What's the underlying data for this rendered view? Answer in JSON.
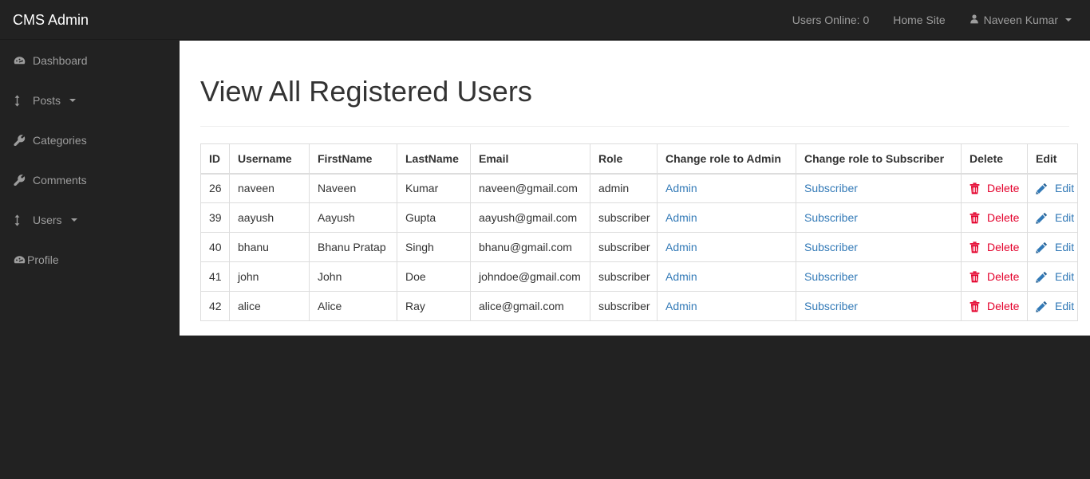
{
  "topbar": {
    "brand": "CMS Admin",
    "items": [
      {
        "label": "Users Online: 0",
        "icon": ""
      },
      {
        "label": "Home Site",
        "icon": ""
      },
      {
        "label": "Naveen Kumar",
        "icon": "user-icon"
      }
    ]
  },
  "sidebar": {
    "items": [
      {
        "label": "Dashboard",
        "icon": "tachometer-icon",
        "caret": false
      },
      {
        "label": "Posts",
        "icon": "arrows-v-icon",
        "caret": true
      },
      {
        "label": "Categories",
        "icon": "wrench-icon",
        "caret": false
      },
      {
        "label": "Comments",
        "icon": "wrench-icon",
        "caret": false
      },
      {
        "label": "Users",
        "icon": "arrows-v-icon",
        "caret": true
      },
      {
        "label": "Profile",
        "icon": "tachometer-icon",
        "caret": false
      }
    ]
  },
  "main": {
    "title": "View All Registered Users",
    "table": {
      "headers": [
        "ID",
        "Username",
        "FirstName",
        "LastName",
        "Email",
        "Role",
        "Change role to Admin",
        "Change role to Subscriber",
        "Delete",
        "Edit"
      ],
      "rows": [
        {
          "id": "26",
          "username": "naveen",
          "firstname": "Naveen",
          "lastname": "Kumar",
          "email": "naveen@gmail.com",
          "role": "admin",
          "to_admin": "Admin",
          "to_subscriber": "Subscriber",
          "delete": "Delete",
          "edit": "Edit"
        },
        {
          "id": "39",
          "username": "aayush",
          "firstname": "Aayush",
          "lastname": "Gupta",
          "email": "aayush@gmail.com",
          "role": "subscriber",
          "to_admin": "Admin",
          "to_subscriber": "Subscriber",
          "delete": "Delete",
          "edit": "Edit"
        },
        {
          "id": "40",
          "username": "bhanu",
          "firstname": "Bhanu Pratap",
          "lastname": "Singh",
          "email": "bhanu@gmail.com",
          "role": "subscriber",
          "to_admin": "Admin",
          "to_subscriber": "Subscriber",
          "delete": "Delete",
          "edit": "Edit"
        },
        {
          "id": "41",
          "username": "john",
          "firstname": "John",
          "lastname": "Doe",
          "email": "johndoe@gmail.com",
          "role": "subscriber",
          "to_admin": "Admin",
          "to_subscriber": "Subscriber",
          "delete": "Delete",
          "edit": "Edit"
        },
        {
          "id": "42",
          "username": "alice",
          "firstname": "Alice",
          "lastname": "Ray",
          "email": "alice@gmail.com",
          "role": "subscriber",
          "to_admin": "Admin",
          "to_subscriber": "Subscriber",
          "delete": "Delete",
          "edit": "Edit"
        }
      ]
    }
  },
  "colors": {
    "dark_bg": "#222222",
    "link_blue": "#337ab7",
    "danger_red": "#e4002b",
    "text": "#333333",
    "muted_nav_text": "#9d9d9d",
    "table_border": "#dddddd"
  }
}
